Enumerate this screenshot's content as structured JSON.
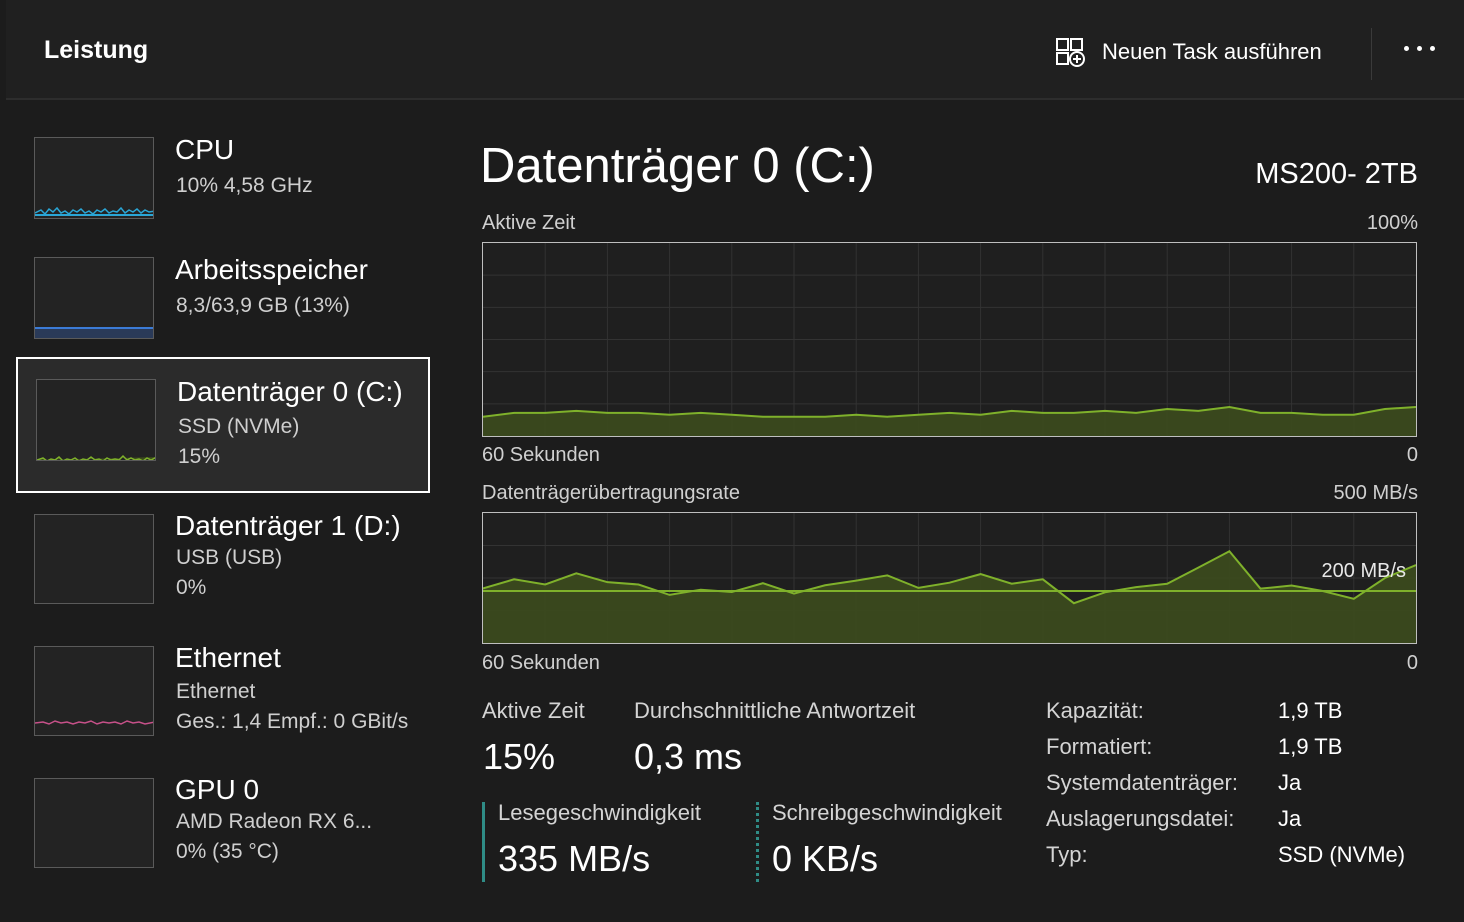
{
  "header": {
    "title": "Leistung",
    "new_task_label": "Neuen Task ausführen",
    "more_icon": "more-icon"
  },
  "sidebar": {
    "items": [
      {
        "name": "CPU",
        "line1": "10%  4,58 GHz",
        "line2": "",
        "graph_color": "#2aa6d6"
      },
      {
        "name": "Arbeitsspeicher",
        "line1": "8,3/63,9 GB (13%)",
        "line2": "",
        "graph_color": "#3b7bd6"
      },
      {
        "name": "Datenträger 0 (C:)",
        "line1": "SSD (NVMe)",
        "line2": "15%",
        "graph_color": "#7fb12b",
        "selected": true
      },
      {
        "name": "Datenträger 1 (D:)",
        "line1": "USB (USB)",
        "line2": "0%",
        "graph_color": "#7fb12b"
      },
      {
        "name": "Ethernet",
        "line1": "Ethernet",
        "line2": "Ges.: 1,4 Empf.: 0 GBit/s",
        "graph_color": "#c8518a"
      },
      {
        "name": "GPU 0",
        "line1": "AMD Radeon RX 6...",
        "line2": "0%  (35 °C)",
        "graph_color": "#2aa6d6"
      }
    ]
  },
  "main": {
    "title": "Datenträger 0 (C:)",
    "model": "MS200- 2TB",
    "chart1": {
      "label": "Aktive Zeit",
      "max": "100%",
      "xleft": "60 Sekunden",
      "xright": "0"
    },
    "chart2": {
      "label": "Datenträgerübertragungsrate",
      "max": "500 MB/s",
      "marker": "200 MB/s",
      "xleft": "60 Sekunden",
      "xright": "0"
    },
    "stats": {
      "active_label": "Aktive Zeit",
      "active_value": "15%",
      "response_label": "Durchschnittliche Antwortzeit",
      "response_value": "0,3 ms",
      "read_label": "Lesegeschwindigkeit",
      "read_value": "335 MB/s",
      "write_label": "Schreibgeschwindigkeit",
      "write_value": "0 KB/s"
    },
    "properties": [
      {
        "label": "Kapazität:",
        "value": "1,9 TB"
      },
      {
        "label": "Formatiert:",
        "value": "1,9 TB"
      },
      {
        "label": "Systemdatenträger:",
        "value": "Ja"
      },
      {
        "label": "Auslagerungsdatei:",
        "value": "Ja"
      },
      {
        "label": "Typ:",
        "value": "SSD (NVMe)"
      }
    ]
  },
  "chart_data": [
    {
      "type": "area",
      "title": "Aktive Zeit",
      "xlabel": "60 Sekunden",
      "ylim": [
        0,
        100
      ],
      "x": [
        60,
        58,
        56,
        54,
        52,
        50,
        48,
        46,
        44,
        42,
        40,
        38,
        36,
        34,
        32,
        30,
        28,
        26,
        24,
        22,
        20,
        18,
        16,
        14,
        12,
        10,
        8,
        6,
        4,
        2,
        0
      ],
      "values": [
        10,
        12,
        12,
        13,
        12,
        12,
        11,
        12,
        11,
        10,
        10,
        10,
        11,
        10,
        11,
        12,
        11,
        13,
        12,
        12,
        13,
        12,
        14,
        13,
        15,
        12,
        12,
        11,
        11,
        14,
        15
      ],
      "color": "#7fb12b"
    },
    {
      "type": "area",
      "title": "Datenträgerübertragungsrate",
      "xlabel": "60 Sekunden",
      "ylim": [
        0,
        500
      ],
      "reference_line": 200,
      "x": [
        60,
        58,
        56,
        54,
        52,
        50,
        48,
        46,
        44,
        42,
        40,
        38,
        36,
        34,
        32,
        30,
        28,
        26,
        24,
        22,
        20,
        18,
        16,
        14,
        12,
        10,
        8,
        6,
        4,
        2,
        0
      ],
      "values": [
        210,
        245,
        225,
        268,
        234,
        225,
        185,
        205,
        196,
        230,
        190,
        222,
        240,
        260,
        212,
        232,
        265,
        228,
        245,
        153,
        195,
        215,
        228,
        290,
        353,
        209,
        221,
        200,
        170,
        250,
        300
      ],
      "color": "#7fb12b"
    }
  ]
}
